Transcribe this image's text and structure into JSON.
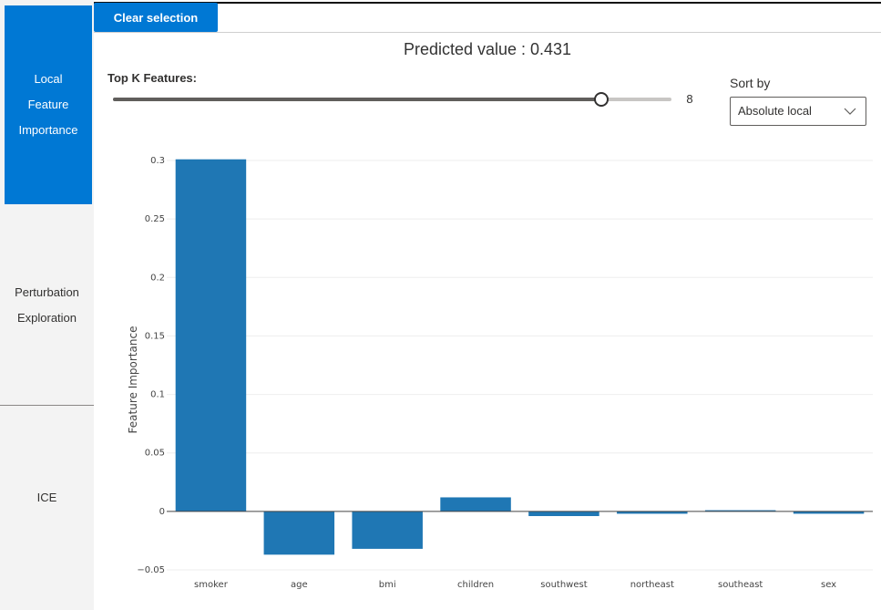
{
  "nav": {
    "items": [
      {
        "label": "Local\nFeature\nImportance",
        "active": true
      },
      {
        "label": "Perturbation\nExploration",
        "active": false
      },
      {
        "label": "ICE",
        "active": false
      }
    ]
  },
  "toolbar": {
    "clear_label": "Clear selection"
  },
  "prediction": {
    "text": "Predicted value : 0.431"
  },
  "topk": {
    "label": "Top K Features:",
    "value": 8,
    "display": "8",
    "min": 1,
    "max": 9
  },
  "sort": {
    "label": "Sort by",
    "selected": "Absolute local"
  },
  "colors": {
    "accent": "#0078d4",
    "bar": "#1f77b4"
  },
  "chart_data": {
    "type": "bar",
    "ylabel": "Feature Importance",
    "xlabel": "",
    "title": "",
    "categories": [
      "smoker",
      "age",
      "bmi",
      "children",
      "southwest",
      "northeast",
      "southeast",
      "sex"
    ],
    "values": [
      0.301,
      -0.037,
      -0.032,
      0.012,
      -0.004,
      -0.002,
      0.001,
      -0.002
    ],
    "ylim": [
      -0.05,
      0.3
    ],
    "yticks": [
      -0.05,
      0,
      0.05,
      0.1,
      0.15,
      0.2,
      0.25,
      0.3
    ],
    "ytick_labels": [
      "−0.05",
      "0",
      "0.05",
      "0.1",
      "0.15",
      "0.2",
      "0.25",
      "0.3"
    ],
    "grid": true,
    "legend": "none"
  }
}
